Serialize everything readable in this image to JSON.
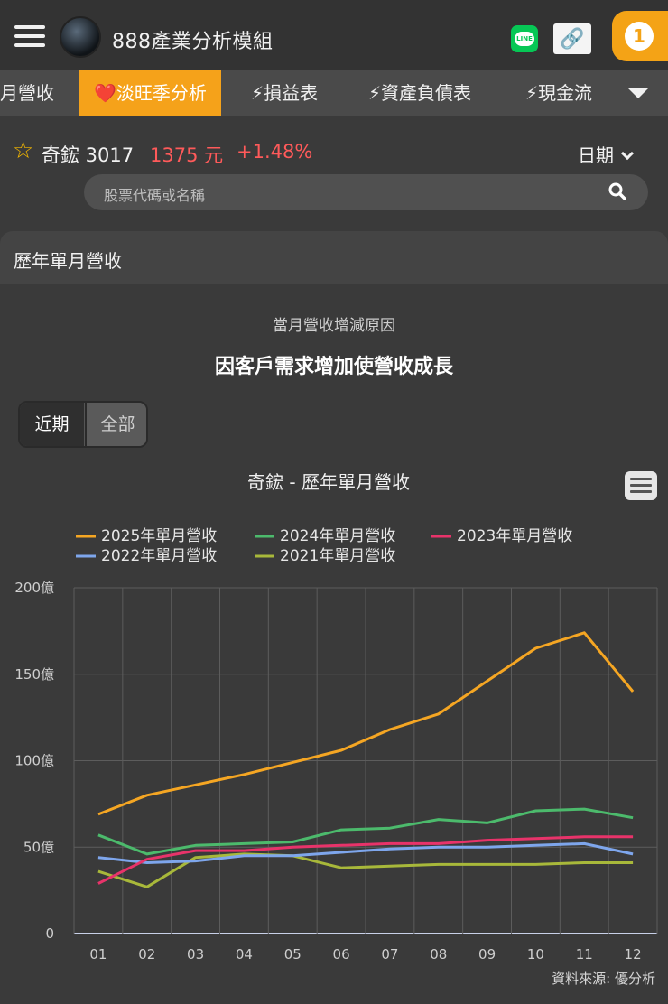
{
  "app": {
    "title": "888產業分析模組",
    "notification_count": "1",
    "line_label": "LINE",
    "link_glyph": "🔗"
  },
  "tabs": [
    {
      "label": "月營收",
      "active": false
    },
    {
      "label": "❤️淡旺季分析",
      "active": true
    },
    {
      "label": "⚡損益表",
      "active": false
    },
    {
      "label": "⚡資產負債表",
      "active": false
    },
    {
      "label": "⚡現金流",
      "active": false
    }
  ],
  "stock": {
    "name": "奇鋐 3017",
    "price": "1375 元",
    "change": "+1.48%",
    "star": "☆"
  },
  "date_selector": {
    "label": "日期"
  },
  "search": {
    "placeholder": "股票代碼或名稱"
  },
  "section": {
    "title": "歷年單月營收"
  },
  "reason": {
    "label": "當月營收增減原因",
    "text": "因客戶需求增加使營收成長"
  },
  "toggle": {
    "recent": "近期",
    "all": "全部"
  },
  "source": "資料來源: 優分析",
  "colors": {
    "accent": "#f5a21a",
    "price_up": "#ff5a5a",
    "background": "#3a3a3a"
  },
  "chart_data": {
    "type": "line",
    "title": "奇鋐 - 歷年單月營收",
    "categories": [
      "01",
      "02",
      "03",
      "04",
      "05",
      "06",
      "07",
      "08",
      "09",
      "10",
      "11",
      "12"
    ],
    "y_ticks": [
      "0",
      "50億",
      "100億",
      "150億",
      "200億"
    ],
    "ylim": [
      0,
      200
    ],
    "grid": true,
    "legend_position": "top",
    "series": [
      {
        "name": "2025年單月營收",
        "color": "#f5a623",
        "values": [
          69,
          80,
          86,
          92,
          99,
          106,
          118,
          127,
          146,
          165,
          174,
          140
        ]
      },
      {
        "name": "2024年單月營收",
        "color": "#4cba6c",
        "values": [
          57,
          46,
          51,
          52,
          53,
          60,
          61,
          66,
          64,
          71,
          72,
          67
        ]
      },
      {
        "name": "2023年單月營收",
        "color": "#e8336a",
        "values": [
          29,
          43,
          48,
          48,
          50,
          51,
          52,
          52,
          54,
          55,
          56,
          56
        ]
      },
      {
        "name": "2022年單月營收",
        "color": "#7ea6ec",
        "values": [
          44,
          41,
          42,
          45,
          45,
          47,
          49,
          50,
          50,
          51,
          52,
          46
        ]
      },
      {
        "name": "2021年單月營收",
        "color": "#a8b83a",
        "values": [
          36,
          27,
          44,
          46,
          45,
          38,
          39,
          40,
          40,
          40,
          41,
          41
        ]
      }
    ]
  }
}
